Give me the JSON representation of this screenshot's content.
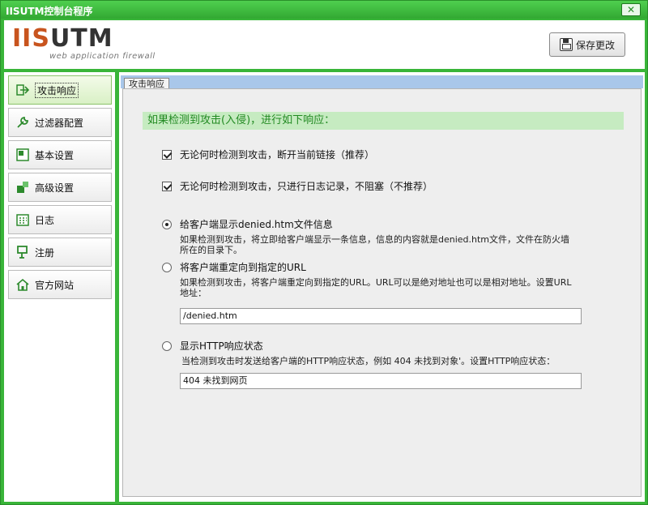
{
  "window": {
    "title": "IISUTM控制台程序",
    "close_label": "✕"
  },
  "header": {
    "brand_prefix": "IIS",
    "brand_rest": "UTM",
    "tagline": "web application firewall",
    "save_label": "保存更改"
  },
  "sidebar": {
    "items": [
      {
        "label": "攻击响应",
        "icon": "arrow-right-icon"
      },
      {
        "label": "过滤器配置",
        "icon": "wrench-icon"
      },
      {
        "label": "基本设置",
        "icon": "settings-icon"
      },
      {
        "label": "高级设置",
        "icon": "advanced-icon"
      },
      {
        "label": "日志",
        "icon": "calendar-icon"
      },
      {
        "label": "注册",
        "icon": "register-icon"
      },
      {
        "label": "官方网站",
        "icon": "home-icon"
      }
    ]
  },
  "main": {
    "tab_label": "攻击响应",
    "banner": "如果检测到攻击(入侵)，进行如下响应：",
    "option_disconnect": {
      "label": "无论何时检测到攻击，断开当前链接（推荐）",
      "checked": true
    },
    "option_logonly": {
      "label": "无论何时检测到攻击，只进行日志记录，不阻塞（不推荐）",
      "checked": true
    },
    "option_denied": {
      "label": "给客户端显示denied.htm文件信息",
      "selected": true,
      "desc_line1": "如果检测到攻击，将立即给客户端显示一条信息，信息的内容就是denied.htm文件，文件在防火墙",
      "desc_line2": "所在的目录下。"
    },
    "option_redirect": {
      "label": "将客户端重定向到指定的URL",
      "selected": false,
      "desc_line1": "如果检测到攻击，将客户端重定向到指定的URL。URL可以是绝对地址也可以是相对地址。设置URL",
      "desc_line2": "地址：",
      "value": "/denied.htm"
    },
    "option_http": {
      "label": "显示HTTP响应状态",
      "selected": false,
      "desc": "当检测到攻击时发送给客户端的HTTP响应状态，例如 404 未找到对象'。设置HTTP响应状态：",
      "value": "404 未找到网页"
    }
  }
}
